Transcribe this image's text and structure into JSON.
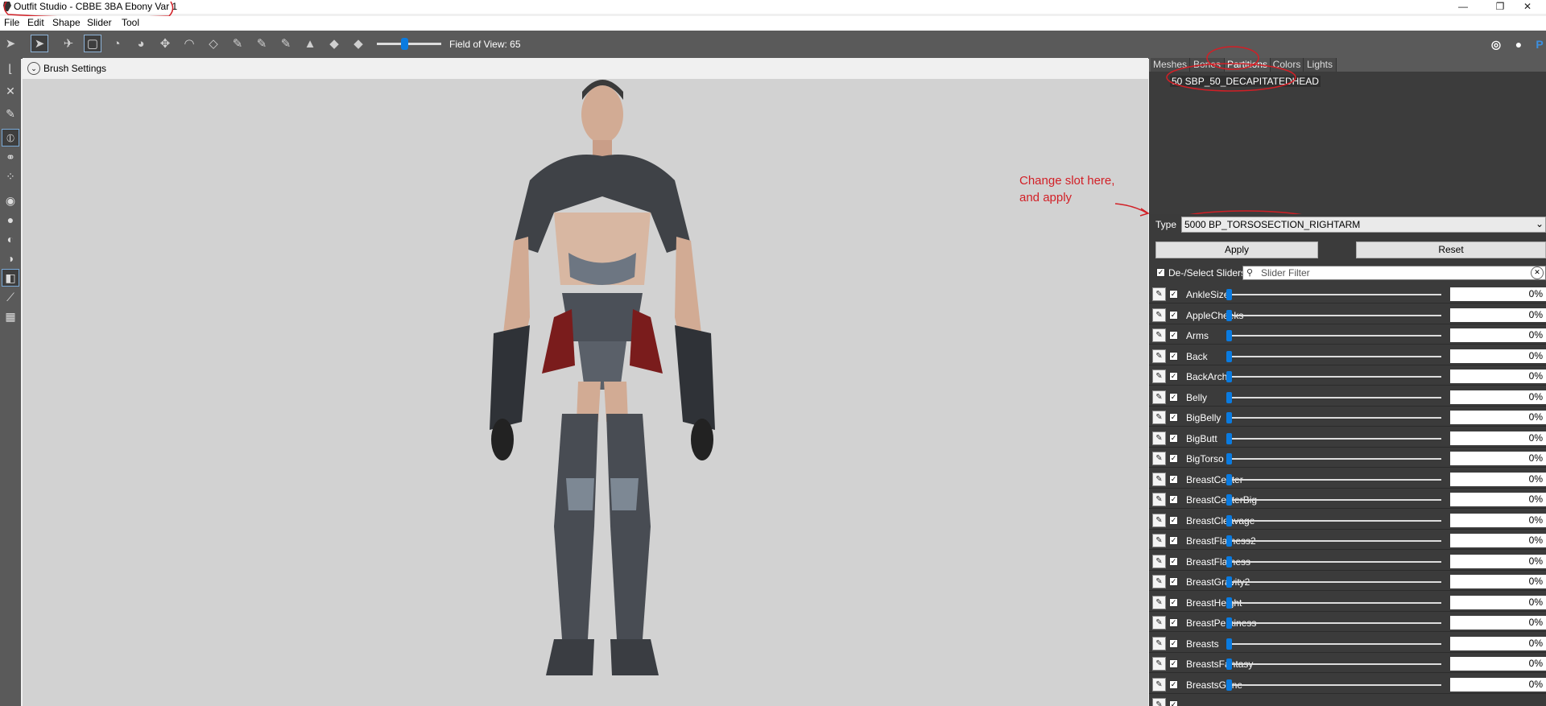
{
  "window": {
    "title": "Outfit Studio - CBBE 3BA Ebony Var 1",
    "minimize": "—",
    "maximize": "❐",
    "close": "✕"
  },
  "menu": [
    "File",
    "Edit",
    "Shape",
    "Slider",
    "Tool"
  ],
  "toolbar": {
    "fov_label": "Field of View: 65",
    "fov_value": 65
  },
  "brush_settings": {
    "label": "Brush Settings"
  },
  "annotation": {
    "line1": "Change slot here,",
    "line2": "and apply",
    "color": "#d21f26"
  },
  "tabs": [
    "Meshes",
    "Bones",
    "Partitions",
    "Colors",
    "Lights"
  ],
  "active_tab": "Partitions",
  "partitions": [
    "50 SBP_50_DECAPITATEDHEAD"
  ],
  "type": {
    "label": "Type",
    "value": "5000 BP_TORSOSECTION_RIGHTARM"
  },
  "buttons": {
    "apply": "Apply",
    "reset": "Reset"
  },
  "slider_controls": {
    "deselect_label": "De-/Select Sliders",
    "filter_placeholder": "Slider Filter"
  },
  "sliders": [
    {
      "name": "AnkleSize",
      "value": "0%"
    },
    {
      "name": "AppleCheeks",
      "value": "0%"
    },
    {
      "name": "Arms",
      "value": "0%"
    },
    {
      "name": "Back",
      "value": "0%"
    },
    {
      "name": "BackArch",
      "value": "0%"
    },
    {
      "name": "Belly",
      "value": "0%"
    },
    {
      "name": "BigBelly",
      "value": "0%"
    },
    {
      "name": "BigButt",
      "value": "0%"
    },
    {
      "name": "BigTorso",
      "value": "0%"
    },
    {
      "name": "BreastCenter",
      "value": "0%"
    },
    {
      "name": "BreastCenterBig",
      "value": "0%"
    },
    {
      "name": "BreastCleavage",
      "value": "0%"
    },
    {
      "name": "BreastFlatness2",
      "value": "0%"
    },
    {
      "name": "BreastFlatness",
      "value": "0%"
    },
    {
      "name": "BreastGravity2",
      "value": "0%"
    },
    {
      "name": "BreastHeight",
      "value": "0%"
    },
    {
      "name": "BreastPerkiness",
      "value": "0%"
    },
    {
      "name": "Breasts",
      "value": "0%"
    },
    {
      "name": "BreastsFantasy",
      "value": "0%"
    },
    {
      "name": "BreastsGone",
      "value": "0%"
    }
  ],
  "colors": {
    "accent": "#0a7be0",
    "toolbar": "#5a5a5a",
    "panel": "#3b3b3b",
    "viewport": "#d2d2d2"
  }
}
